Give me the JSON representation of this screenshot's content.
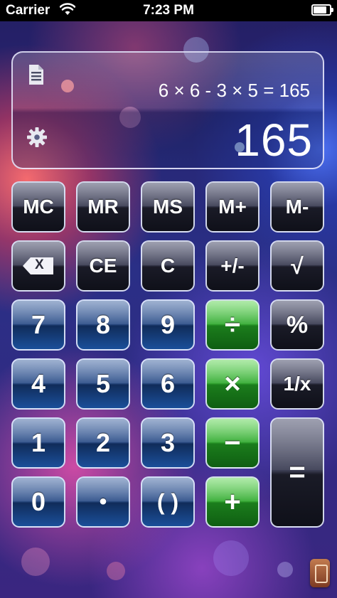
{
  "status_bar": {
    "carrier": "Carrier",
    "time": "7:23 PM",
    "battery_level": 0.9
  },
  "display": {
    "expression": "6 × 6 - 3 × 5 = 165",
    "result": "165",
    "doc_icon": "document-icon",
    "settings_icon": "gear-icon"
  },
  "keys": {
    "mc": "MC",
    "mr": "MR",
    "ms": "MS",
    "m_plus": "M+",
    "m_minus": "M-",
    "backspace_label": "X",
    "ce": "CE",
    "c": "C",
    "sign": "+/-",
    "sqrt": "√",
    "seven": "7",
    "eight": "8",
    "nine": "9",
    "divide": "÷",
    "percent": "%",
    "four": "4",
    "five": "5",
    "six": "6",
    "multiply": "×",
    "reciprocal": "1/x",
    "one": "1",
    "two": "2",
    "three": "3",
    "minus": "−",
    "equals": "=",
    "zero": "0",
    "decimal": "•",
    "parens": "( )",
    "plus": "+"
  },
  "colors": {
    "memory_keys": "#1a1b27",
    "number_keys": "#1b4f9a",
    "operator_keys": "#37ad35"
  }
}
